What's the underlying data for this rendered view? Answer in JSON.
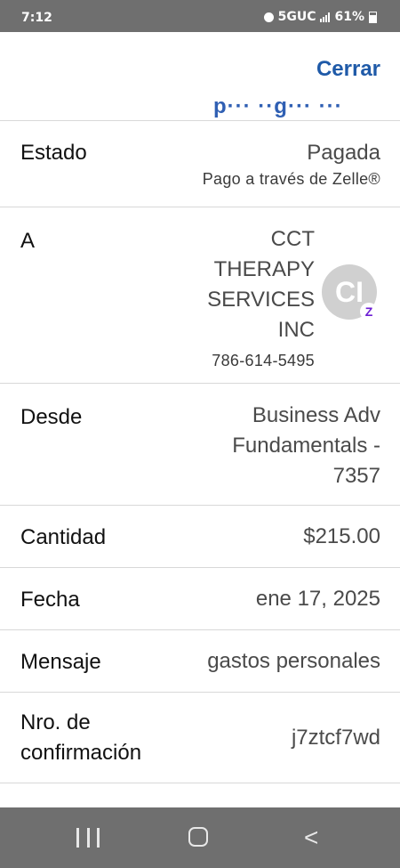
{
  "status_bar": {
    "time": "7:12",
    "network": "5GUC",
    "battery": "61%"
  },
  "header": {
    "partial_title": "p··· ··g··· ···",
    "close_label": "Cerrar"
  },
  "rows": {
    "estado": {
      "label": "Estado",
      "value": "Pagada",
      "sub": "Pago a través de Zelle®"
    },
    "to": {
      "label": "A",
      "name_lines": [
        "CCT",
        "THERAPY",
        "SERVICES",
        "INC"
      ],
      "phone": "786-614-5495",
      "avatar_initials": "CI",
      "badge": "Z"
    },
    "desde": {
      "label": "Desde",
      "value_lines": [
        "Business Adv",
        "Fundamentals -",
        "7357"
      ]
    },
    "cantidad": {
      "label": "Cantidad",
      "value": "$215.00"
    },
    "fecha": {
      "label": "Fecha",
      "value": "ene 17, 2025"
    },
    "mensaje": {
      "label": "Mensaje",
      "value": "gastos personales"
    },
    "confirmacion": {
      "label_lines": [
        "Nro. de",
        "confirmación"
      ],
      "value": "j7ztcf7wd"
    }
  },
  "icons": {
    "status": [
      "alarm-icon",
      "signal-icon",
      "battery-icon"
    ],
    "nav": [
      "recents-icon",
      "home-icon",
      "back-icon"
    ]
  }
}
